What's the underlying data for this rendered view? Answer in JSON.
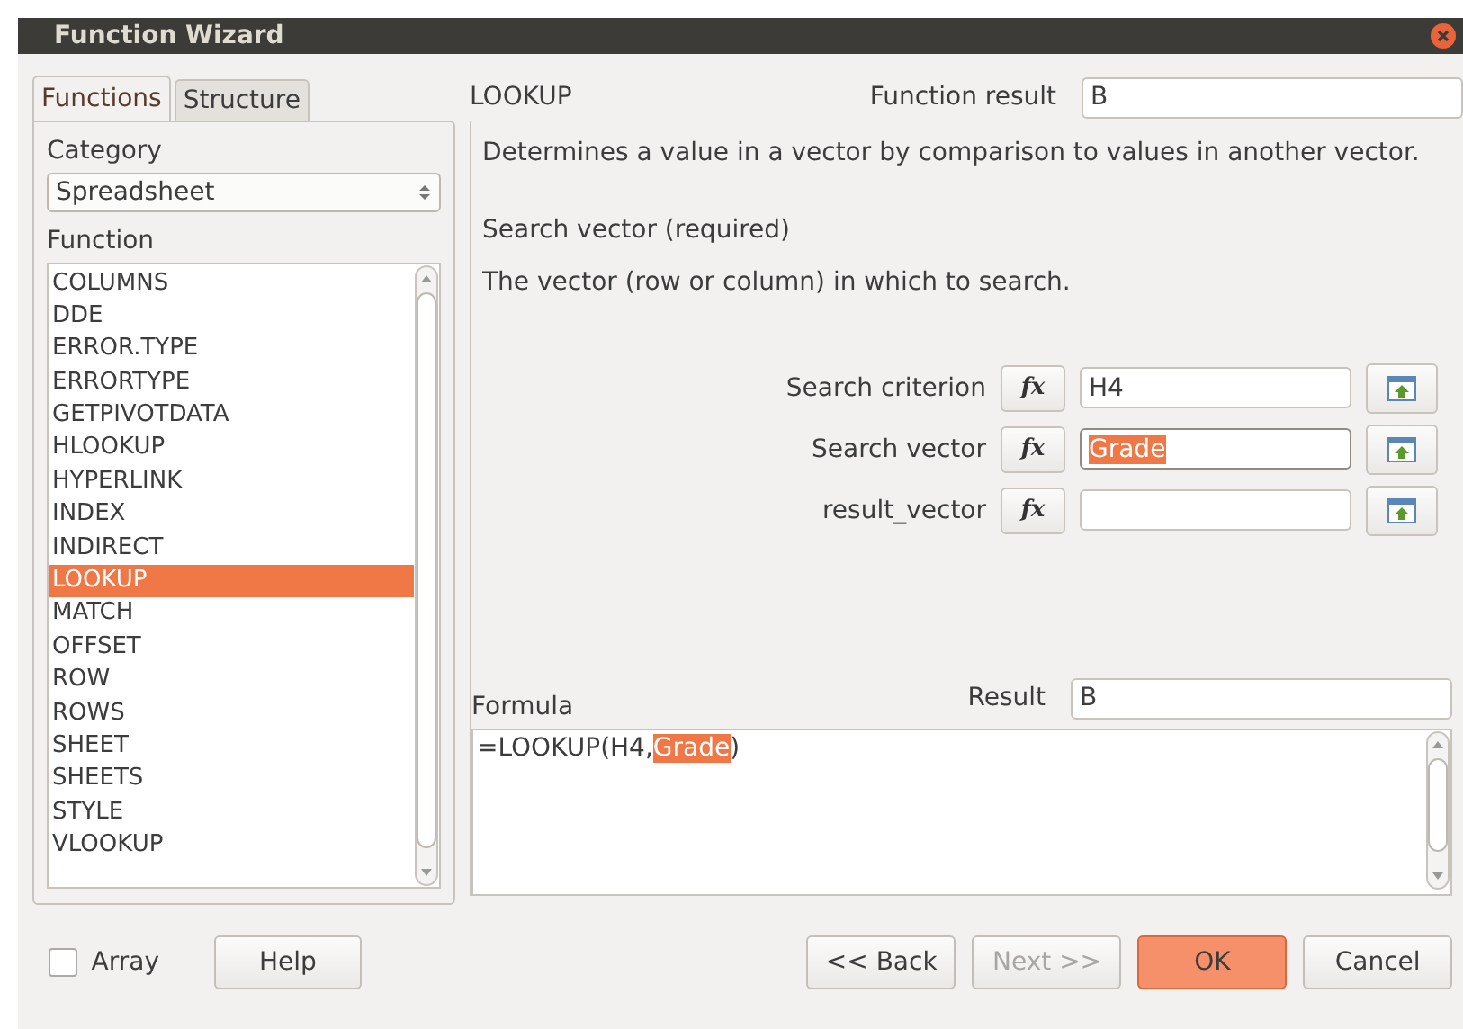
{
  "window": {
    "title": "Function Wizard"
  },
  "tabs": [
    {
      "label": "Functions",
      "selected": true
    },
    {
      "label": "Structure",
      "selected": false
    }
  ],
  "category": {
    "label": "Category",
    "value": "Spreadsheet"
  },
  "function_list": {
    "label": "Function",
    "items": [
      {
        "label": "COLUMNS",
        "selected": false
      },
      {
        "label": "DDE",
        "selected": false
      },
      {
        "label": "ERROR.TYPE",
        "selected": false
      },
      {
        "label": "ERRORTYPE",
        "selected": false
      },
      {
        "label": "GETPIVOTDATA",
        "selected": false
      },
      {
        "label": "HLOOKUP",
        "selected": false
      },
      {
        "label": "HYPERLINK",
        "selected": false
      },
      {
        "label": "INDEX",
        "selected": false
      },
      {
        "label": "INDIRECT",
        "selected": false
      },
      {
        "label": "LOOKUP",
        "selected": true
      },
      {
        "label": "MATCH",
        "selected": false
      },
      {
        "label": "OFFSET",
        "selected": false
      },
      {
        "label": "ROW",
        "selected": false
      },
      {
        "label": "ROWS",
        "selected": false
      },
      {
        "label": "SHEET",
        "selected": false
      },
      {
        "label": "SHEETS",
        "selected": false
      },
      {
        "label": "STYLE",
        "selected": false
      },
      {
        "label": "VLOOKUP",
        "selected": false
      }
    ]
  },
  "function_name": "LOOKUP",
  "function_result": {
    "label": "Function result",
    "value": "B"
  },
  "description": "Determines a value in a vector by comparison to values in another vector.",
  "argument_title": "Search vector (required)",
  "argument_description": "The vector (row or column) in which to search.",
  "arguments": [
    {
      "label": "Search criterion",
      "fx": "fx",
      "value": "H4",
      "selected": false
    },
    {
      "label": "Search vector",
      "fx": "fx",
      "value": "Grade",
      "selected": true
    },
    {
      "label": "result_vector",
      "fx": "fx",
      "selected": false
    }
  ],
  "formula": {
    "label": "Formula",
    "before": "=LOOKUP(H4,",
    "selected": "Grade",
    "after": ")"
  },
  "result": {
    "label": "Result",
    "value": "B"
  },
  "array": {
    "label": "Array",
    "checked": false
  },
  "buttons": [
    {
      "label": "Help",
      "kind": "normal",
      "disabled": false
    },
    {
      "label": "<< Back",
      "kind": "normal",
      "disabled": false
    },
    {
      "label": "Next >>",
      "kind": "normal",
      "disabled": true
    },
    {
      "label": "OK",
      "kind": "default",
      "disabled": false
    },
    {
      "label": "Cancel",
      "kind": "normal",
      "disabled": false
    }
  ]
}
